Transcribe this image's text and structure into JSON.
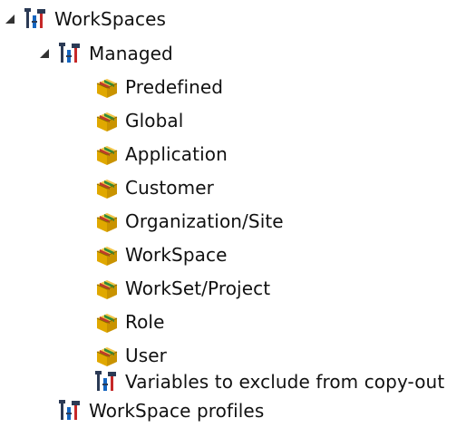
{
  "tree": {
    "root": {
      "label": "WorkSpaces",
      "icon": "tools-icon",
      "expanded": true
    },
    "managed": {
      "label": "Managed",
      "icon": "tools-icon",
      "expanded": true,
      "items": [
        {
          "label": "Predefined",
          "icon": "package-icon"
        },
        {
          "label": "Global",
          "icon": "package-icon"
        },
        {
          "label": "Application",
          "icon": "package-icon"
        },
        {
          "label": "Customer",
          "icon": "package-icon"
        },
        {
          "label": "Organization/Site",
          "icon": "package-icon"
        },
        {
          "label": "WorkSpace",
          "icon": "package-icon"
        },
        {
          "label": "WorkSet/Project",
          "icon": "package-icon"
        },
        {
          "label": "Role",
          "icon": "package-icon"
        },
        {
          "label": "User",
          "icon": "package-icon"
        }
      ],
      "extra": {
        "label": "Variables to exclude from copy-out",
        "icon": "tools-icon"
      }
    },
    "profiles": {
      "label": "WorkSpace profiles",
      "icon": "tools-icon"
    }
  },
  "colors": {
    "tools_dark": "#2b3a55",
    "tools_red": "#c62828",
    "tools_blue": "#1565c0",
    "package_gold": "#e0a800",
    "package_red": "#c0392b",
    "package_green": "#2e8b3a",
    "expander": "#333333"
  }
}
